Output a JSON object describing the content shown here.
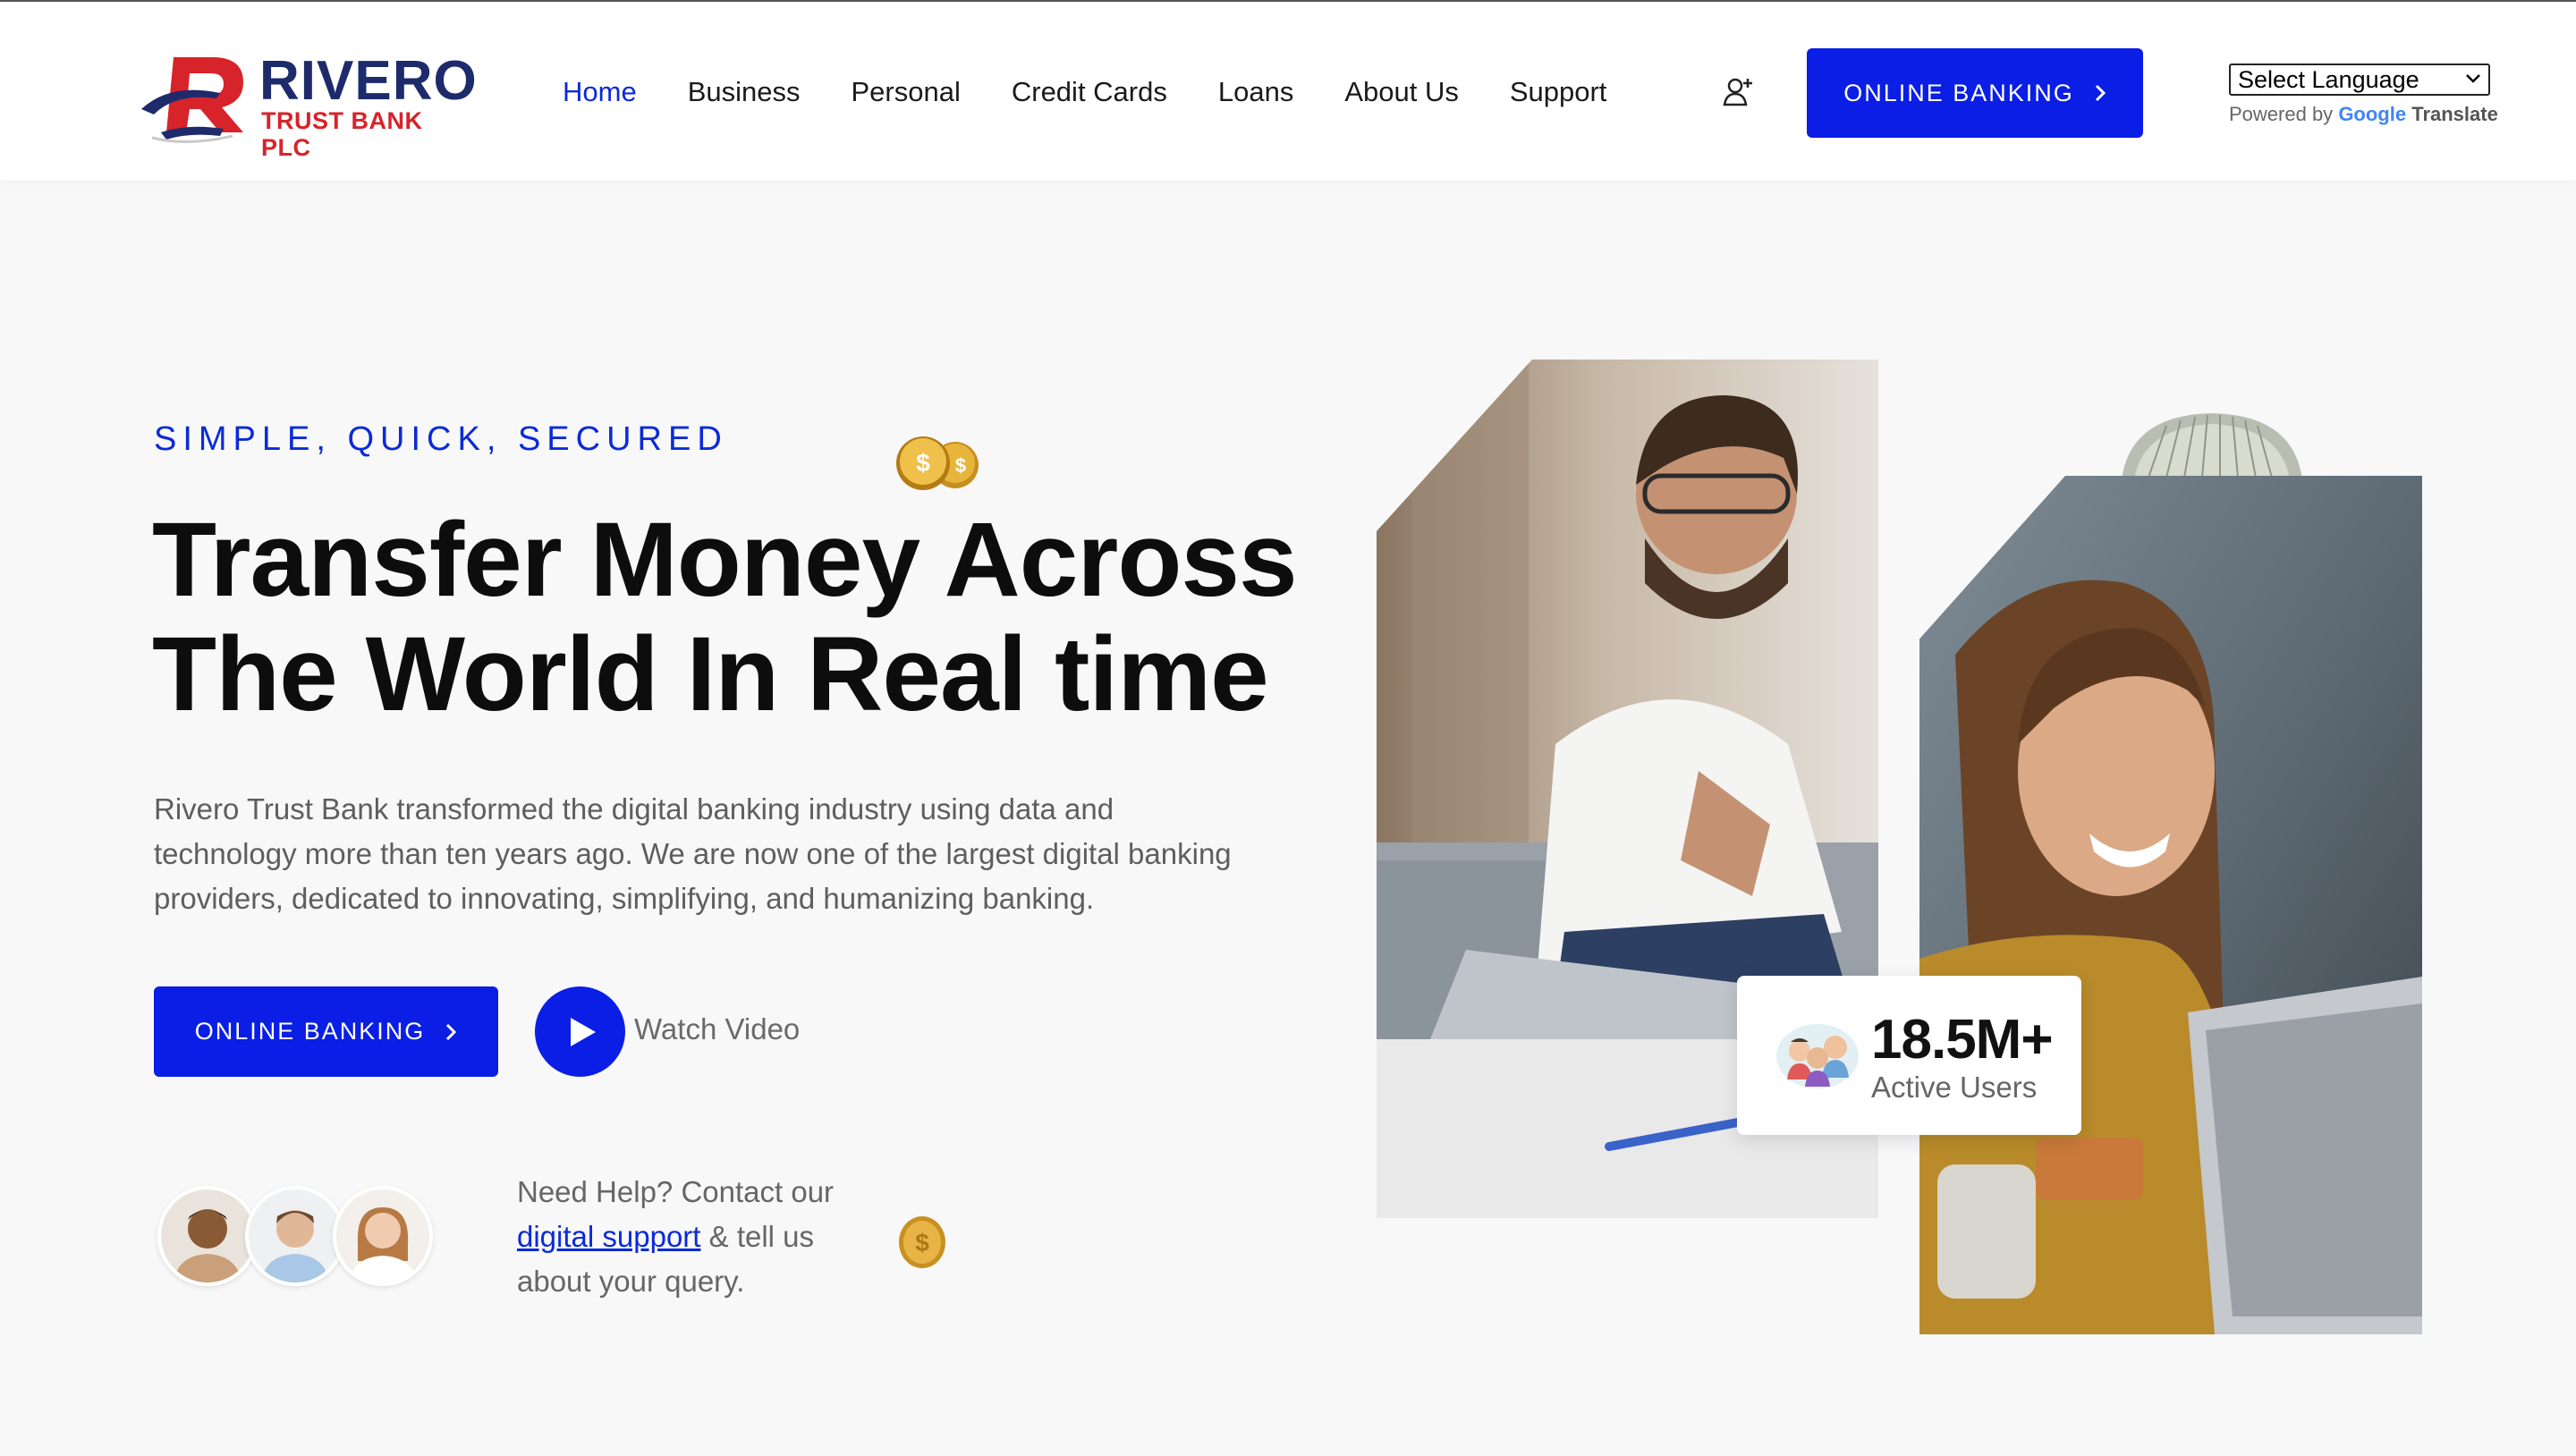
{
  "brand": {
    "name": "RIVERO",
    "subtitle": "TRUST BANK PLC",
    "colors": {
      "navy": "#1d2b6c",
      "red": "#d7232a"
    }
  },
  "nav": {
    "items": [
      {
        "label": "Home",
        "active": true
      },
      {
        "label": "Business",
        "active": false
      },
      {
        "label": "Personal",
        "active": false
      },
      {
        "label": "Credit Cards",
        "active": false
      },
      {
        "label": "Loans",
        "active": false
      },
      {
        "label": "About Us",
        "active": false
      },
      {
        "label": "Support",
        "active": false
      }
    ],
    "user_icon": "user-add-icon",
    "cta_label": "ONLINE BANKING"
  },
  "translate": {
    "select_value": "Select Language",
    "powered_by": "Powered by",
    "google": "Google",
    "translate": "Translate"
  },
  "hero": {
    "eyebrow": "SIMPLE, QUICK, SECURED",
    "headline_line1": "Transfer Money Across",
    "headline_line2": "The World In Real time",
    "description_line1": "Rivero Trust Bank transformed the digital banking industry using data and",
    "description_line2": "technology more than ten years ago. We are now one of the largest digital banking",
    "description_line3": "providers, dedicated to innovating, simplifying, and humanizing banking.",
    "cta_label": "ONLINE BANKING",
    "watch_label": "Watch Video",
    "help_line1": "Need Help? Contact our",
    "help_link": "digital support",
    "help_after_link": " & tell us",
    "help_line3": "about your query."
  },
  "stats": {
    "users_value": "18.5M+",
    "users_label": "Active Users"
  },
  "colors": {
    "accent": "#0a1ee6",
    "link": "#0b2ad8",
    "background": "#f8f8f8"
  }
}
